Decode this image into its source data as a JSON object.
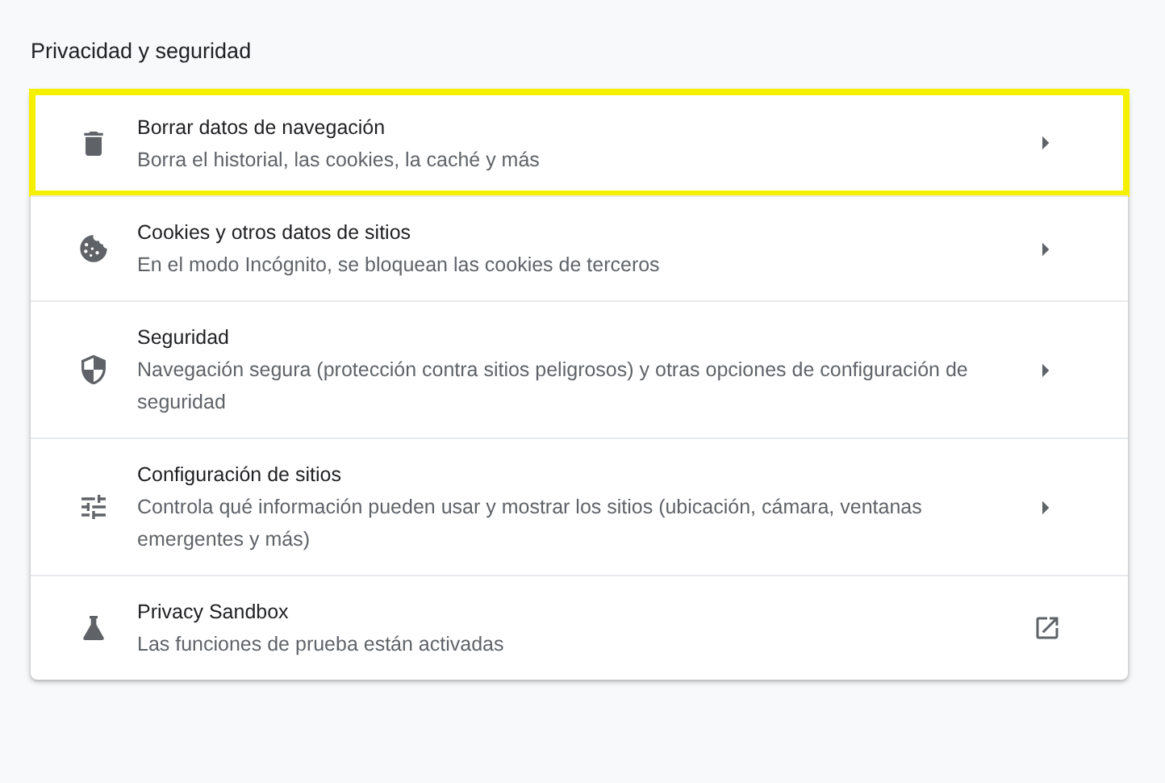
{
  "section_title": "Privacidad y seguridad",
  "items": [
    {
      "kind": "subpage",
      "title": "Borrar datos de navegación",
      "description": "Borra el historial, las cookies, la caché y más",
      "highlighted": true
    },
    {
      "kind": "subpage",
      "title": "Cookies y otros datos de sitios",
      "description": "En el modo Incógnito, se bloquean las cookies de terceros",
      "highlighted": false
    },
    {
      "kind": "subpage",
      "title": "Seguridad",
      "description": "Navegación segura (protección contra sitios peligrosos) y otras opciones de configuración de seguridad",
      "highlighted": false
    },
    {
      "kind": "subpage",
      "title": "Configuración de sitios",
      "description": "Controla qué información pueden usar y mostrar los sitios (ubicación, cámara, ventanas emergentes y más)",
      "highlighted": false
    },
    {
      "kind": "external",
      "title": "Privacy Sandbox",
      "description": "Las funciones de prueba están activadas",
      "highlighted": false
    }
  ]
}
